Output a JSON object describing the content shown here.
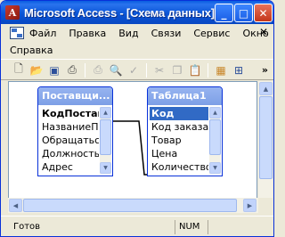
{
  "window": {
    "title": "Microsoft Access - [Схема данных]",
    "app_icon_letter": "A",
    "minimize_glyph": "_",
    "maximize_glyph": "□",
    "close_glyph": "✕"
  },
  "menu": {
    "row1": [
      "Файл",
      "Правка",
      "Вид",
      "Связи",
      "Сервис",
      "Окно"
    ],
    "row2": [
      "Справка"
    ],
    "close_glyph": "✕"
  },
  "toolbar": {
    "icons": [
      "new-file-icon",
      "open-folder-icon",
      "save-icon",
      "print-preview-icon",
      "print-icon",
      "preview-icon",
      "spellcheck-icon",
      "cut-icon",
      "copy-icon",
      "paste-icon",
      "show-table-icon",
      "relationships-icon",
      "more-icon"
    ],
    "more_glyph": "»"
  },
  "tables": [
    {
      "title": "Поставщи...",
      "fields": [
        "КодПоставщ",
        "НазваниеПос",
        "ОбращатьсяК",
        "Должность",
        "Адрес"
      ]
    },
    {
      "title": "Таблица1",
      "fields": [
        "Код",
        "Код заказа",
        "Товар",
        "Цена",
        "Количество"
      ]
    }
  ],
  "status": {
    "text": "Готов",
    "num": "NUM"
  }
}
